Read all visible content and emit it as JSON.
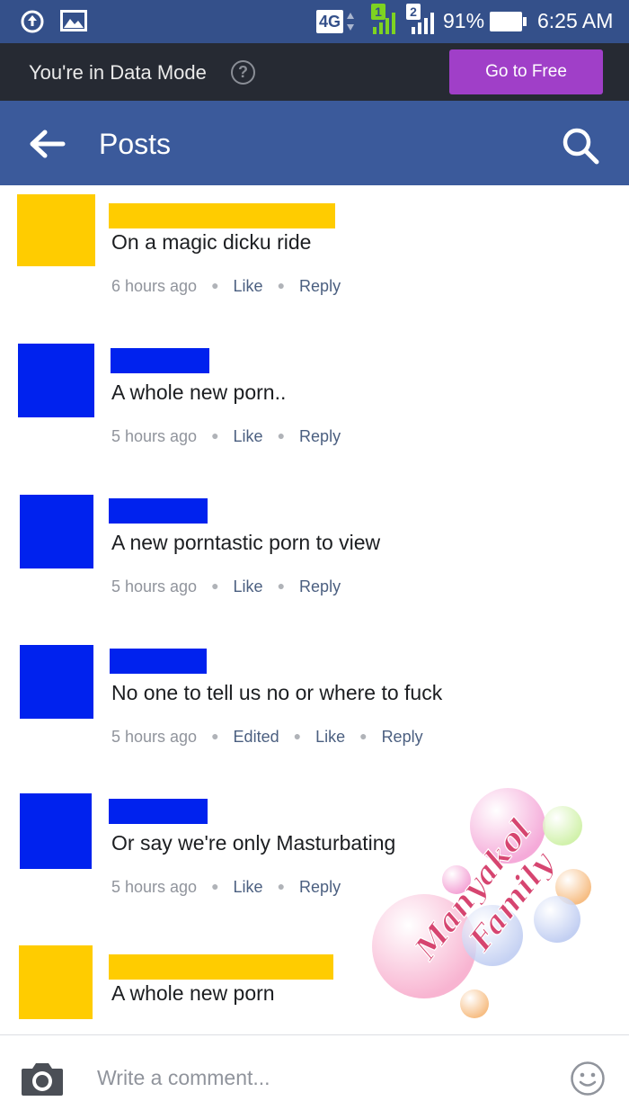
{
  "status_bar": {
    "network": "4G",
    "sim1": "1",
    "sim2": "2",
    "battery": "91%",
    "time": "6:25 AM"
  },
  "data_mode": {
    "message": "You're in Data Mode",
    "help": "?",
    "button": "Go to Free"
  },
  "nav": {
    "title": "Posts"
  },
  "colors": {
    "facebook_blue": "#3b5a9b",
    "status_bar": "#34508a",
    "go_free": "#a03fc8",
    "redact_yellow": "#ffcc00",
    "redact_blue": "#0022ee"
  },
  "comments": [
    {
      "text": "On a magic dicku  ride",
      "time": "6 hours ago",
      "edited": "",
      "like": "Like",
      "reply": "Reply"
    },
    {
      "text": "A whole new porn..",
      "time": "5 hours ago",
      "edited": "",
      "like": "Like",
      "reply": "Reply"
    },
    {
      "text": "A new porntastic porn to view",
      "time": "5 hours ago",
      "edited": "",
      "like": "Like",
      "reply": "Reply"
    },
    {
      "text": "No one to tell us no or where to fuck",
      "time": "5 hours ago",
      "edited": "Edited",
      "like": "Like",
      "reply": "Reply"
    },
    {
      "text": "Or say we're only Masturbating",
      "time": "5 hours ago",
      "edited": "",
      "like": "Like",
      "reply": "Reply"
    },
    {
      "text": "A whole new porn",
      "time": "",
      "edited": "",
      "like": "",
      "reply": ""
    }
  ],
  "watermark": {
    "line1": "Manyakol",
    "line2": "Family"
  },
  "composer": {
    "placeholder": "Write a comment..."
  }
}
